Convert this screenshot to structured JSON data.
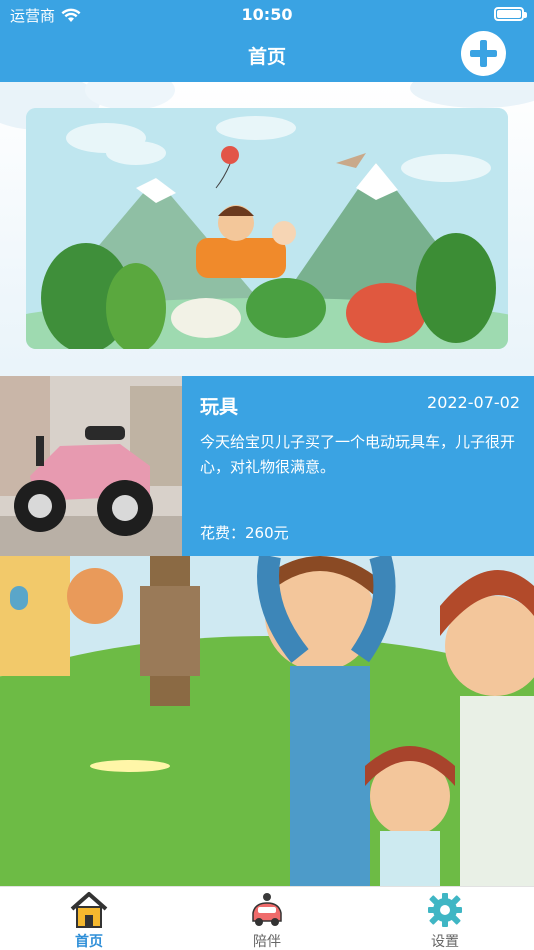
{
  "status_bar": {
    "carrier": "运营商",
    "time": "10:50"
  },
  "nav": {
    "title": "首页"
  },
  "record": {
    "title": "玩具",
    "date": "2022-07-02",
    "description": "今天给宝贝儿子买了一个电动玩具车，儿子很开心，对礼物很满意。",
    "cost": "花费：260元"
  },
  "tabs": [
    {
      "label": "首页",
      "icon": "home-icon",
      "active": true
    },
    {
      "label": "陪伴",
      "icon": "car-icon",
      "active": false
    },
    {
      "label": "设置",
      "icon": "gear-icon",
      "active": false
    }
  ],
  "colors": {
    "primary": "#3aa3e3",
    "tab_active": "#2f8fd8",
    "tab_inactive": "#666666"
  }
}
